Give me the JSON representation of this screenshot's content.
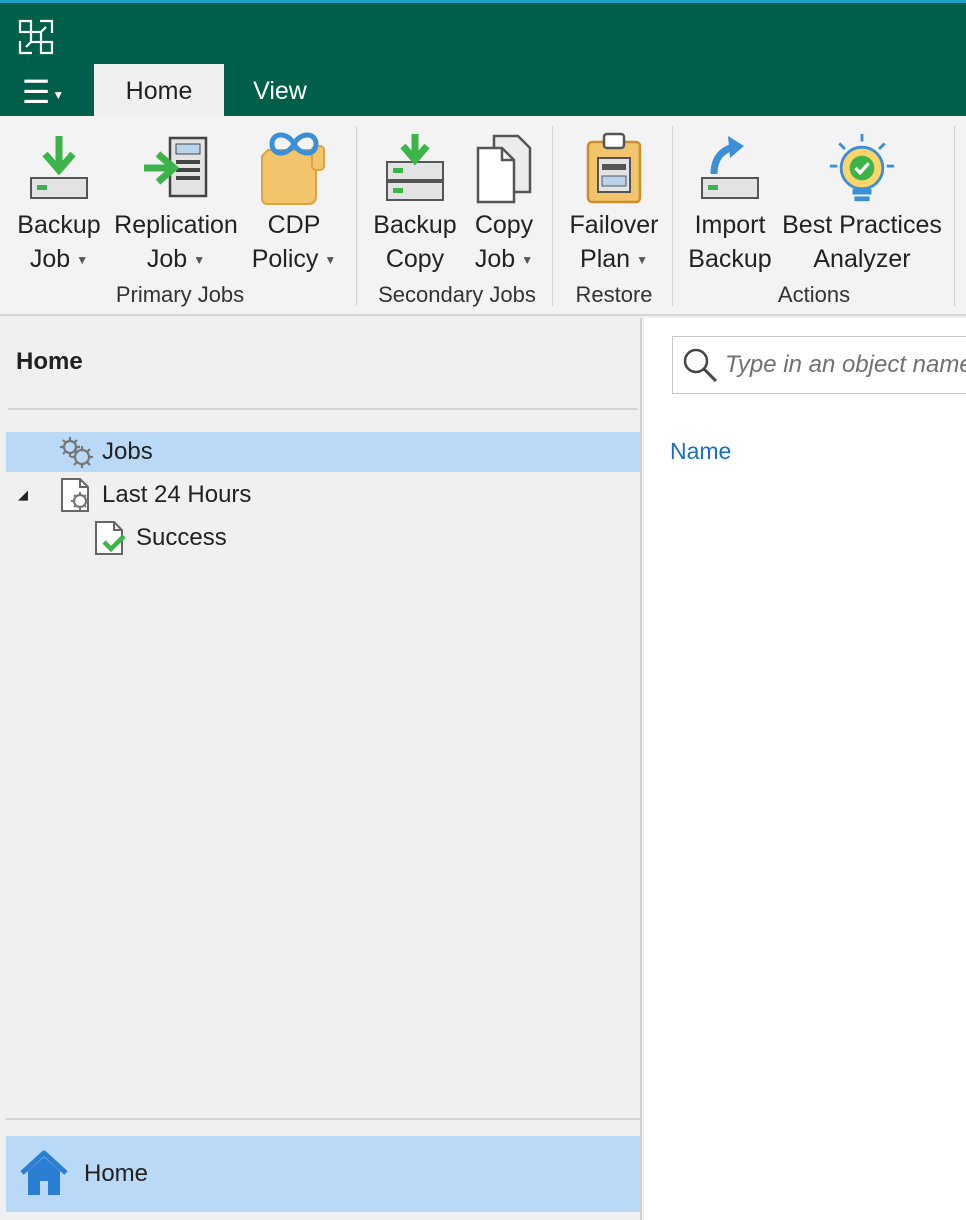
{
  "tabs": {
    "home": "Home",
    "view": "View"
  },
  "ribbon": {
    "backup_job": {
      "line1": "Backup",
      "line2": "Job"
    },
    "replication_job": {
      "line1": "Replication",
      "line2": "Job"
    },
    "cdp_policy": {
      "line1": "CDP",
      "line2": "Policy"
    },
    "backup_copy": {
      "line1": "Backup",
      "line2": "Copy"
    },
    "copy_job": {
      "line1": "Copy",
      "line2": "Job"
    },
    "failover_plan": {
      "line1": "Failover",
      "line2": "Plan"
    },
    "import_backup": {
      "line1": "Import",
      "line2": "Backup"
    },
    "best_practices": {
      "line1": "Best Practices",
      "line2": "Analyzer"
    },
    "groups": {
      "primary": "Primary Jobs",
      "secondary": "Secondary Jobs",
      "restore": "Restore",
      "actions": "Actions"
    }
  },
  "nav": {
    "title": "Home",
    "tree": [
      {
        "label": "Jobs"
      },
      {
        "label": "Last 24 Hours"
      },
      {
        "label": "Success"
      }
    ],
    "bottom_home": "Home"
  },
  "content": {
    "search_placeholder": "Type in an object name to search for",
    "column_name": "Name"
  },
  "colors": {
    "titlebar": "#005f4b",
    "selection": "#b9d9f7",
    "link": "#1a6fc4",
    "accent_green": "#3cb44a"
  },
  "icons": {
    "app_logo": "veeam-logo-icon",
    "menu": "hamburger-menu-icon",
    "search": "search-icon",
    "home": "home-icon"
  }
}
